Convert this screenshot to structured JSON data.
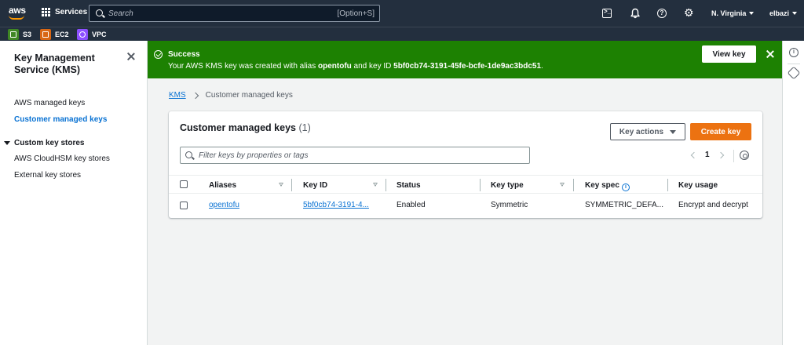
{
  "topnav": {
    "logo_text": "aws",
    "services_label": "Services",
    "search_placeholder": "Search",
    "search_shortcut": "[Option+S]",
    "region": "N. Virginia",
    "user": "elbazi",
    "icons": [
      "cloudshell-icon",
      "bell-icon",
      "help-icon",
      "gear-icon"
    ]
  },
  "favorites": [
    {
      "label": "S3",
      "color": "#3f8624"
    },
    {
      "label": "EC2",
      "color": "#d86613"
    },
    {
      "label": "VPC",
      "color": "#8c4fff"
    }
  ],
  "sidebar": {
    "title": "Key Management Service (KMS)",
    "items": [
      {
        "label": "AWS managed keys",
        "active": false
      },
      {
        "label": "Customer managed keys",
        "active": true
      }
    ],
    "section": {
      "label": "Custom key stores",
      "items": [
        {
          "label": "AWS CloudHSM key stores"
        },
        {
          "label": "External key stores"
        }
      ]
    }
  },
  "flash": {
    "title": "Success",
    "message_prefix": "Your AWS KMS key was created with alias ",
    "alias": "opentofu",
    "message_middle": " and key ID ",
    "key_id": "5bf0cb74-3191-45fe-bcfe-1de9ac3bdc51",
    "message_suffix": ".",
    "button_label": "View key",
    "color": "#1d8102"
  },
  "breadcrumb": {
    "root": "KMS",
    "current": "Customer managed keys"
  },
  "table": {
    "title": "Customer managed keys",
    "count": "(1)",
    "actions_label": "Key actions",
    "create_label": "Create key",
    "filter_placeholder": "Filter keys by properties or tags",
    "page": "1",
    "columns": {
      "aliases": "Aliases",
      "key_id": "Key ID",
      "status": "Status",
      "key_type": "Key type",
      "key_spec": "Key spec",
      "key_usage": "Key usage"
    },
    "rows": [
      {
        "alias": "opentofu",
        "key_id": "5bf0cb74-3191-4...",
        "status": "Enabled",
        "key_type": "Symmetric",
        "key_spec": "SYMMETRIC_DEFA...",
        "key_usage": "Encrypt and decrypt"
      }
    ]
  },
  "colors": {
    "accent": "#0972d3",
    "primary_button": "#ec7211",
    "nav_bg": "#232f3e"
  }
}
